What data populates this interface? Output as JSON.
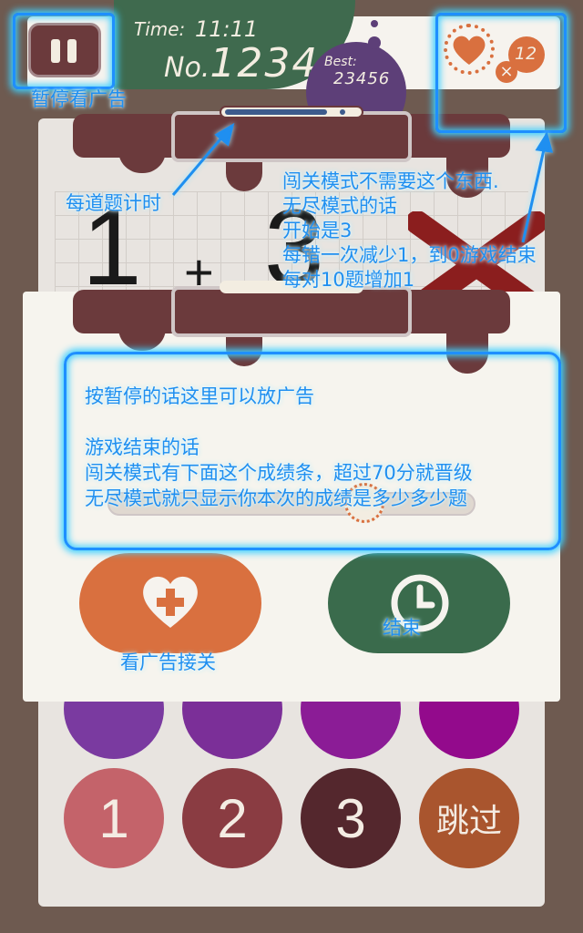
{
  "header": {
    "time_label": "Time:",
    "time_value": "11:11",
    "no_prefix": "No.",
    "number": "1234",
    "best_label": "Best:",
    "best_value": "23456",
    "lives": "12"
  },
  "game": {
    "digit1": "1",
    "operator": "+",
    "digit2": "3",
    "numbers": [
      "1",
      "2",
      "3"
    ],
    "skip_label": "跳过"
  },
  "annotations": {
    "pause_ad": "暂停看广告",
    "timer_note": "每道题计时",
    "mode_note": [
      "闯关模式不需要这个东西.",
      "无尽模式的话",
      "开始是3",
      "每错一次减少1，到0游戏结束",
      "每对10题增加1"
    ],
    "dialog_note": [
      "按暂停的话这里可以放广告",
      "",
      "游戏结束的话",
      "闯关模式有下面这个成绩条，超过70分就晋级",
      "无尽模式就只显示你本次的成绩是多少多少题"
    ],
    "watch_ad_continue": "看广告接关",
    "end": "结束"
  },
  "colors": {
    "brown": "#6b3a3c",
    "orange": "#d9703f",
    "green": "#3a6b4c",
    "purple": "#7a3aa0",
    "annotation_blue": "#1f8ff0"
  }
}
